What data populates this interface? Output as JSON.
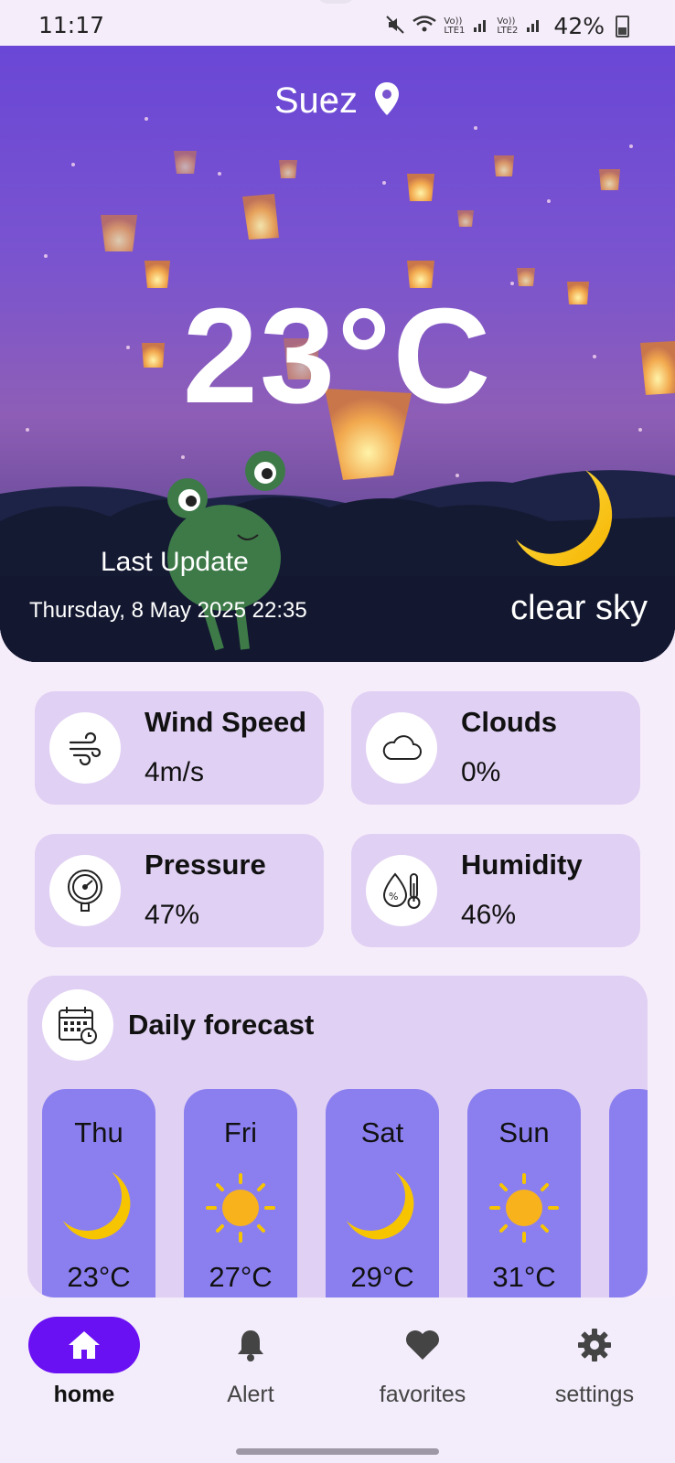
{
  "status_bar": {
    "time": "11:17",
    "battery": "42%",
    "network_labels": [
      "Vo)) LTE1",
      "Vo)) LTE2"
    ]
  },
  "hero": {
    "city": "Suez",
    "temperature": "23°C",
    "last_update_label": "Last Update",
    "datetime": "Thursday, 8 May 2025 22:35",
    "description": "clear sky",
    "weather_icon": "moon-icon"
  },
  "details": [
    {
      "title": "Wind Speed",
      "value": "4m/s",
      "icon": "wind-icon"
    },
    {
      "title": "Clouds",
      "value": "0%",
      "icon": "cloud-icon"
    },
    {
      "title": "Pressure",
      "value": "47%",
      "icon": "pressure-gauge-icon"
    },
    {
      "title": "Humidity",
      "value": "46%",
      "icon": "humidity-thermometer-icon"
    }
  ],
  "daily": {
    "title": "Daily forecast",
    "icon": "calendar-icon",
    "days": [
      {
        "day": "Thu",
        "temp": "23°C",
        "icon": "moon-icon"
      },
      {
        "day": "Fri",
        "temp": "27°C",
        "icon": "sun-icon"
      },
      {
        "day": "Sat",
        "temp": "29°C",
        "icon": "moon-icon"
      },
      {
        "day": "Sun",
        "temp": "31°C",
        "icon": "sun-icon"
      }
    ]
  },
  "nav": {
    "items": [
      {
        "label": "home",
        "icon": "home-icon",
        "active": true
      },
      {
        "label": "Alert",
        "icon": "bell-icon",
        "active": false
      },
      {
        "label": "favorites",
        "icon": "heart-icon",
        "active": false
      },
      {
        "label": "settings",
        "icon": "gear-icon",
        "active": false
      }
    ]
  },
  "colors": {
    "accent": "#6a11f3",
    "card_bg": "#e0d0f3",
    "day_card_bg": "#8b7ff0",
    "page_bg": "#f6edfb"
  }
}
